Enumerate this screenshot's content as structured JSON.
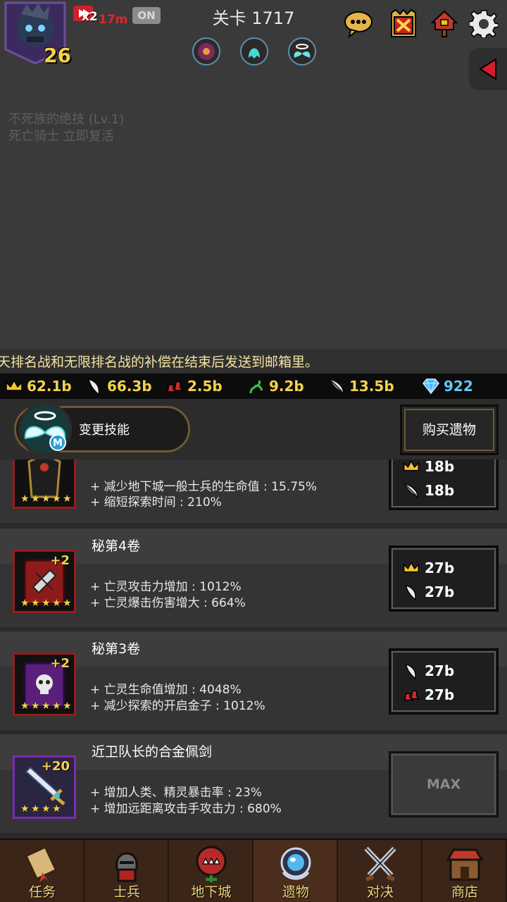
{
  "hud": {
    "level": "26",
    "speed_multiplier": "x2",
    "speed_time": "17m",
    "auto_toggle": "ON",
    "stage_title": "关卡 1717"
  },
  "skill_note": {
    "line1": "不死族的绝技 (Lv.1)",
    "line2": "死亡骑士 立即复活"
  },
  "notice": "天排名战和无限排名战的补偿在结束后发送到邮箱里。",
  "currency": [
    {
      "icon": "crown-icon",
      "value": "62.1b"
    },
    {
      "icon": "claw-icon",
      "value": "66.3b"
    },
    {
      "icon": "red-boots-icon",
      "value": "2.5b"
    },
    {
      "icon": "green-vine-icon",
      "value": "9.2b"
    },
    {
      "icon": "dark-feather-icon",
      "value": "13.5b"
    },
    {
      "icon": "diamond-icon",
      "value": "922"
    }
  ],
  "skill_bar": {
    "change_skill": "变更技能",
    "buy_relic": "购买遗物"
  },
  "relics": [
    {
      "title": "",
      "plus": "",
      "stats": [
        "+ 减少地下城一般士兵的生命值 : 15.75%",
        "+ 缩短探索时间 : 210%"
      ],
      "costs": [
        {
          "icon": "crown-icon",
          "value": "18b"
        },
        {
          "icon": "dark-feather-icon",
          "value": "18b"
        }
      ]
    },
    {
      "title": "秘第4卷",
      "plus": "+2",
      "stats": [
        "+ 亡灵攻击力增加 : 1012%",
        "+ 亡灵爆击伤害增大 : 664%"
      ],
      "costs": [
        {
          "icon": "crown-icon",
          "value": "27b"
        },
        {
          "icon": "claw-icon",
          "value": "27b"
        }
      ]
    },
    {
      "title": "秘第3卷",
      "plus": "+2",
      "stats": [
        "+ 亡灵生命值增加 : 4048%",
        "+ 减少探索的开启金子 : 1012%"
      ],
      "costs": [
        {
          "icon": "claw-icon",
          "value": "27b"
        },
        {
          "icon": "red-boots-icon",
          "value": "27b"
        }
      ]
    },
    {
      "title": "近卫队长的合金佩剑",
      "plus": "+20",
      "stats": [
        "+ 增加人类、精灵暴击率 : 23%",
        "+ 增加远距离攻击手攻击力 : 680%"
      ],
      "max_label": "MAX"
    }
  ],
  "nav": [
    {
      "label": "任务",
      "icon": "scroll-icon"
    },
    {
      "label": "士兵",
      "icon": "soldier-icon"
    },
    {
      "label": "地下城",
      "icon": "monster-plant-icon"
    },
    {
      "label": "遗物",
      "icon": "relic-orb-icon"
    },
    {
      "label": "对决",
      "icon": "crossed-swords-icon"
    },
    {
      "label": "商店",
      "icon": "shop-icon"
    }
  ]
}
